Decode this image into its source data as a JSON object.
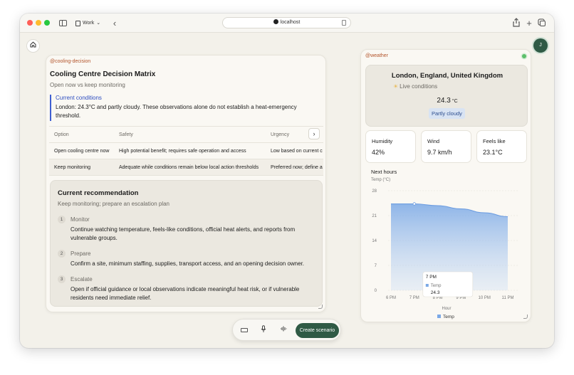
{
  "browser": {
    "profile": "Work",
    "url": "localhost"
  },
  "user": {
    "initial": "J"
  },
  "decision": {
    "tag": "@cooling-decision",
    "title": "Cooling Centre Decision Matrix",
    "subtitle": "Open now vs keep monitoring",
    "conditions_title": "Current conditions",
    "conditions_text": "London: 24.3°C and partly cloudy. These observations alone do not establish a heat-emergency threshold.",
    "columns": [
      "Option",
      "Safety",
      "Urgency"
    ],
    "rows": [
      [
        "Open cooling centre now",
        "High potential benefit; requires safe operation and access",
        "Low based on current c"
      ],
      [
        "Keep monitoring",
        "Adequate while conditions remain below local action thresholds",
        "Preferred now; define a"
      ]
    ],
    "recommendation": {
      "title": "Current recommendation",
      "subtitle": "Keep monitoring; prepare an escalation plan",
      "steps": [
        {
          "num": "1",
          "name": "Monitor",
          "desc": "Continue watching temperature, feels-like conditions, official heat alerts, and reports from vulnerable groups."
        },
        {
          "num": "2",
          "name": "Prepare",
          "desc": "Confirm a site, minimum staffing, supplies, transport access, and an opening decision owner."
        },
        {
          "num": "3",
          "name": "Escalate",
          "desc": "Open if official guidance or local observations indicate meaningful heat risk, or if vulnerable residents need immediate relief."
        }
      ]
    }
  },
  "weather": {
    "tag": "@weather",
    "location": "London, England, United Kingdom",
    "live_label": "Live conditions",
    "temp": "24.3",
    "temp_unit": "°C",
    "condition": "Partly cloudy",
    "metrics": [
      {
        "label": "Humidity",
        "value": "42%"
      },
      {
        "label": "Wind",
        "value": "9.7 km/h"
      },
      {
        "label": "Feels like",
        "value": "23.1°C"
      }
    ],
    "next_hours_label": "Next hours"
  },
  "toolbar": {
    "create_label": "Create scenario"
  },
  "chart_data": {
    "type": "area",
    "ylabel": "Temp (°C)",
    "xlabel": "Hour",
    "categories": [
      "6 PM",
      "7 PM",
      "8 PM",
      "9 PM",
      "10 PM",
      "11 PM"
    ],
    "yticks": [
      0,
      7,
      14,
      21,
      28
    ],
    "ylim": [
      0,
      28
    ],
    "grid": true,
    "legend_position": "bottom",
    "series": [
      {
        "name": "Temp",
        "values": [
          24.3,
          24.3,
          23.8,
          22.9,
          21.8,
          20.7
        ],
        "color": "#7ba9e6"
      }
    ],
    "tooltip": {
      "title": "7 PM",
      "series": "Temp",
      "value": "24.3"
    }
  }
}
